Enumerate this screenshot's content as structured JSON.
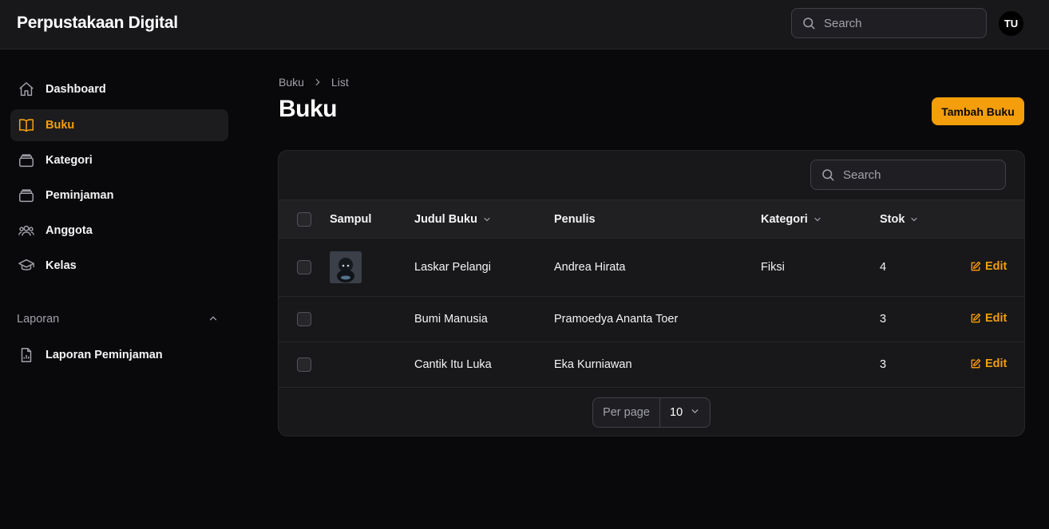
{
  "app": {
    "brand": "Perpustakaan Digital",
    "avatar_initials": "TU",
    "search_placeholder": "Search"
  },
  "sidebar": {
    "items": [
      {
        "label": "Dashboard",
        "icon": "home-icon",
        "active": false
      },
      {
        "label": "Buku",
        "icon": "book-open-icon",
        "active": true
      },
      {
        "label": "Kategori",
        "icon": "stack-icon",
        "active": false
      },
      {
        "label": "Peminjaman",
        "icon": "stack-icon",
        "active": false
      },
      {
        "label": "Anggota",
        "icon": "users-icon",
        "active": false
      },
      {
        "label": "Kelas",
        "icon": "academic-cap-icon",
        "active": false
      }
    ],
    "group": {
      "label": "Laporan",
      "items": [
        {
          "label": "Laporan Peminjaman",
          "icon": "document-chart-icon"
        }
      ]
    }
  },
  "page": {
    "breadcrumb": [
      "Buku",
      "List"
    ],
    "title": "Buku",
    "primary_action": "Tambah Buku"
  },
  "table": {
    "search_placeholder": "Search",
    "columns": [
      "Sampul",
      "Judul Buku",
      "Penulis",
      "Kategori",
      "Stok"
    ],
    "rows": [
      {
        "judul": "Laskar Pelangi",
        "penulis": "Andrea Hirata",
        "kategori": "Fiksi",
        "stok": "4",
        "action": "Edit",
        "has_cover": true
      },
      {
        "judul": "Bumi Manusia",
        "penulis": "Pramoedya Ananta Toer",
        "kategori": "",
        "stok": "3",
        "action": "Edit",
        "has_cover": false
      },
      {
        "judul": "Cantik Itu Luka",
        "penulis": "Eka Kurniawan",
        "kategori": "",
        "stok": "3",
        "action": "Edit",
        "has_cover": false
      }
    ],
    "pagination": {
      "per_page_label": "Per page",
      "per_page_value": "10"
    }
  },
  "colors": {
    "accent": "#f59e0b",
    "background": "#09090b",
    "surface": "#18181b"
  }
}
